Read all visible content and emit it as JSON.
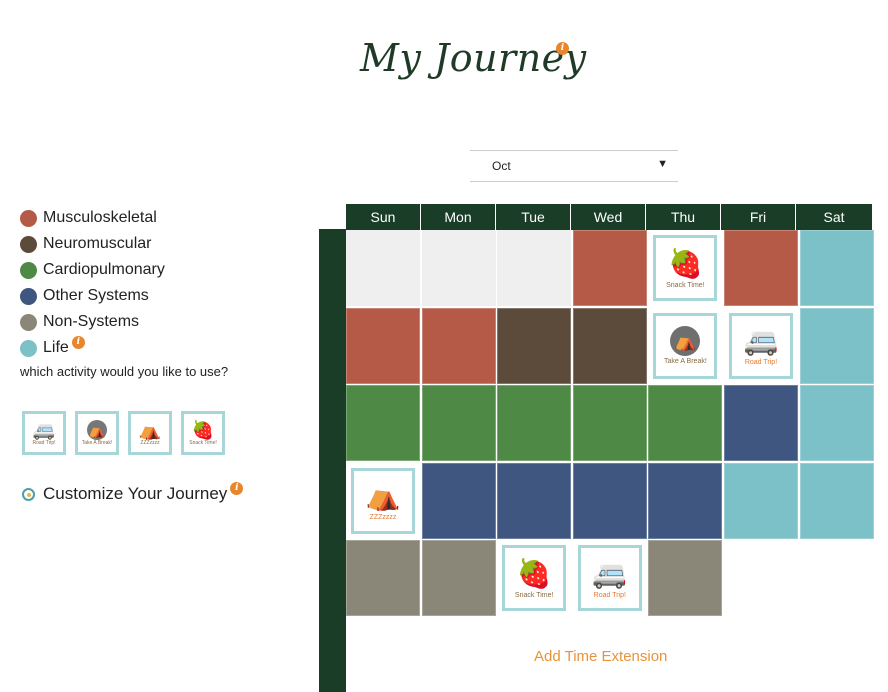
{
  "header": {
    "title": "My Journey",
    "info": "i"
  },
  "month_select": {
    "value": "Oct"
  },
  "legend": {
    "items": [
      {
        "label": "Musculoskeletal",
        "color": "#b45a47"
      },
      {
        "label": "Neuromuscular",
        "color": "#5c4a3a"
      },
      {
        "label": "Cardiopulmonary",
        "color": "#4e8a46"
      },
      {
        "label": "Other Systems",
        "color": "#3e5680"
      },
      {
        "label": "Non-Systems",
        "color": "#8a8778"
      },
      {
        "label": "Life",
        "color": "#7cc1c8"
      }
    ],
    "life_info": "i"
  },
  "question": "which activity would you like to use?",
  "activities": [
    {
      "name": "road-trip",
      "label": "Road Trip!",
      "icon": "🚐"
    },
    {
      "name": "take-a-break",
      "label": "Take A Break!",
      "icon": "⛺"
    },
    {
      "name": "zzzzzz",
      "label": "ZZZzzzz",
      "icon": "⛺"
    },
    {
      "name": "snack-time",
      "label": "Snack Time!",
      "icon": "🍓"
    }
  ],
  "customize": {
    "label": "Customize Your Journey",
    "info": "i"
  },
  "calendar": {
    "days": [
      "Sun",
      "Mon",
      "Tue",
      "Wed",
      "Thu",
      "Fri",
      "Sat"
    ],
    "colors": {
      "musculo": "#b45a47",
      "neuro": "#5c4a3a",
      "cardio": "#4e8a46",
      "other": "#3e5680",
      "non": "#8a8778",
      "life": "#7cc1c8",
      "empty": "#efefef"
    },
    "cards": {
      "snack": {
        "label": "Snack Time!",
        "icon": "🍓"
      },
      "break": {
        "label": "Take A Break!",
        "icon": "⛺"
      },
      "road": {
        "label": "Road Trip!",
        "icon": "🚐"
      },
      "zzz": {
        "label": "ZZZzzzz",
        "icon": "⛺"
      }
    }
  },
  "add_extension": "Add Time Extension"
}
